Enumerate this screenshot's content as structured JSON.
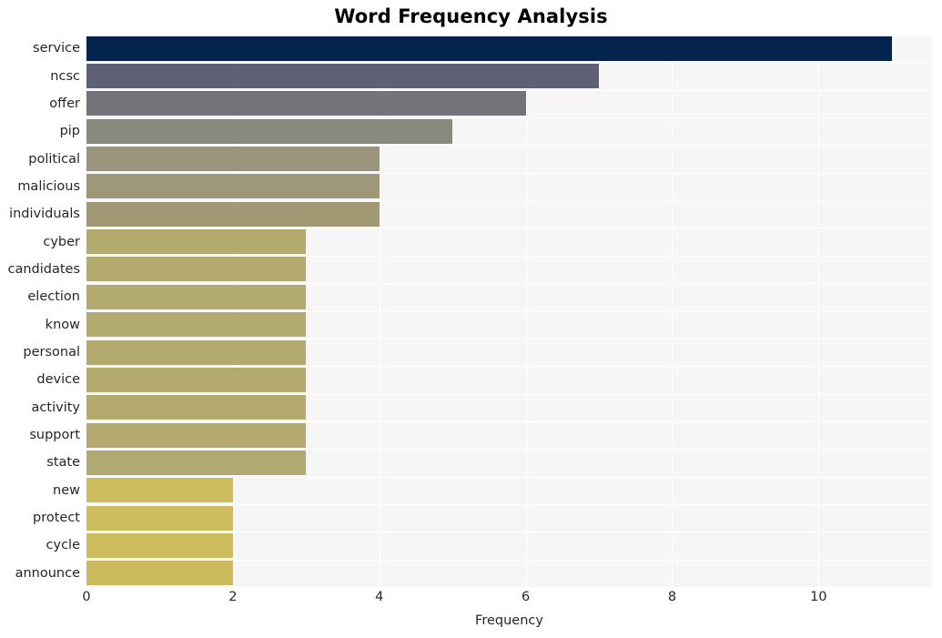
{
  "chart_data": {
    "type": "bar",
    "orientation": "horizontal",
    "title": "Word Frequency Analysis",
    "xlabel": "Frequency",
    "ylabel": "",
    "xlim": [
      0,
      11.55
    ],
    "ylim": [
      0,
      20
    ],
    "grid": true,
    "legend": null,
    "xticks": [
      0,
      2,
      4,
      6,
      8,
      10
    ],
    "xtick_labels": [
      "0",
      "2",
      "4",
      "6",
      "8",
      "10"
    ],
    "categories": [
      "service",
      "ncsc",
      "offer",
      "pip",
      "political",
      "malicious",
      "individuals",
      "cyber",
      "candidates",
      "election",
      "know",
      "personal",
      "device",
      "activity",
      "support",
      "state",
      "new",
      "protect",
      "cycle",
      "announce"
    ],
    "values": [
      11,
      7,
      6,
      5,
      4,
      4,
      4,
      3,
      3,
      3,
      3,
      3,
      3,
      3,
      3,
      3,
      2,
      2,
      2,
      2
    ],
    "bar_colors": [
      "#03244d",
      "#5d6173",
      "#72747a",
      "#888a80",
      "#9a947a",
      "#9f9878",
      "#a09974",
      "#b3aa6e",
      "#b3aa6e",
      "#b3aa6e",
      "#b3aa6e",
      "#b3aa6e",
      "#b3aa6e",
      "#b3aa6e",
      "#b3aa6e",
      "#b1a972",
      "#cdbd5c",
      "#cdbd5c",
      "#cdbd5c",
      "#cbbb5d"
    ],
    "plot_background": "#f6f6f7",
    "figure_background": "#ffffff",
    "gridline_color": "#ffffff",
    "text_color": "#262626"
  }
}
